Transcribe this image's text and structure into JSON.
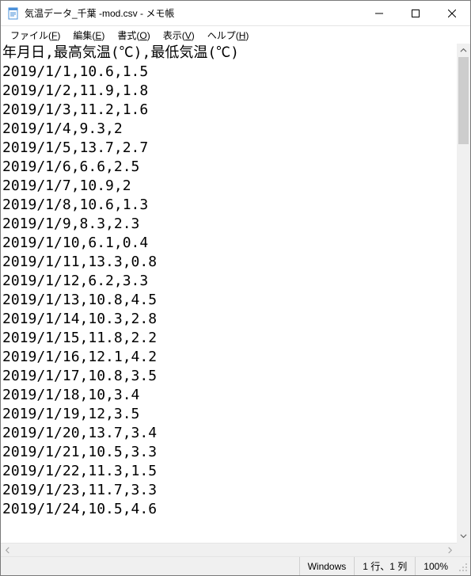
{
  "titlebar": {
    "title": "気温データ_千葉 -mod.csv - メモ帳"
  },
  "menu": {
    "file": "ファイル(",
    "file_u": "F",
    "file_end": ")",
    "edit": "編集(",
    "edit_u": "E",
    "edit_end": ")",
    "format": "書式(",
    "format_u": "O",
    "format_end": ")",
    "view": "表示(",
    "view_u": "V",
    "view_end": ")",
    "help": "ヘルプ(",
    "help_u": "H",
    "help_end": ")"
  },
  "content_lines": [
    "年月日,最高気温(℃),最低気温(℃)",
    "2019/1/1,10.6,1.5",
    "2019/1/2,11.9,1.8",
    "2019/1/3,11.2,1.6",
    "2019/1/4,9.3,2",
    "2019/1/5,13.7,2.7",
    "2019/1/6,6.6,2.5",
    "2019/1/7,10.9,2",
    "2019/1/8,10.6,1.3",
    "2019/1/9,8.3,2.3",
    "2019/1/10,6.1,0.4",
    "2019/1/11,13.3,0.8",
    "2019/1/12,6.2,3.3",
    "2019/1/13,10.8,4.5",
    "2019/1/14,10.3,2.8",
    "2019/1/15,11.8,2.2",
    "2019/1/16,12.1,4.2",
    "2019/1/17,10.8,3.5",
    "2019/1/18,10,3.4",
    "2019/1/19,12,3.5",
    "2019/1/20,13.7,3.4",
    "2019/1/21,10.5,3.3",
    "2019/1/22,11.3,1.5",
    "2019/1/23,11.7,3.3",
    "2019/1/24,10.5,4.6"
  ],
  "status": {
    "encoding": "Windows",
    "position": "1 行、1 列",
    "zoom": "100%"
  }
}
